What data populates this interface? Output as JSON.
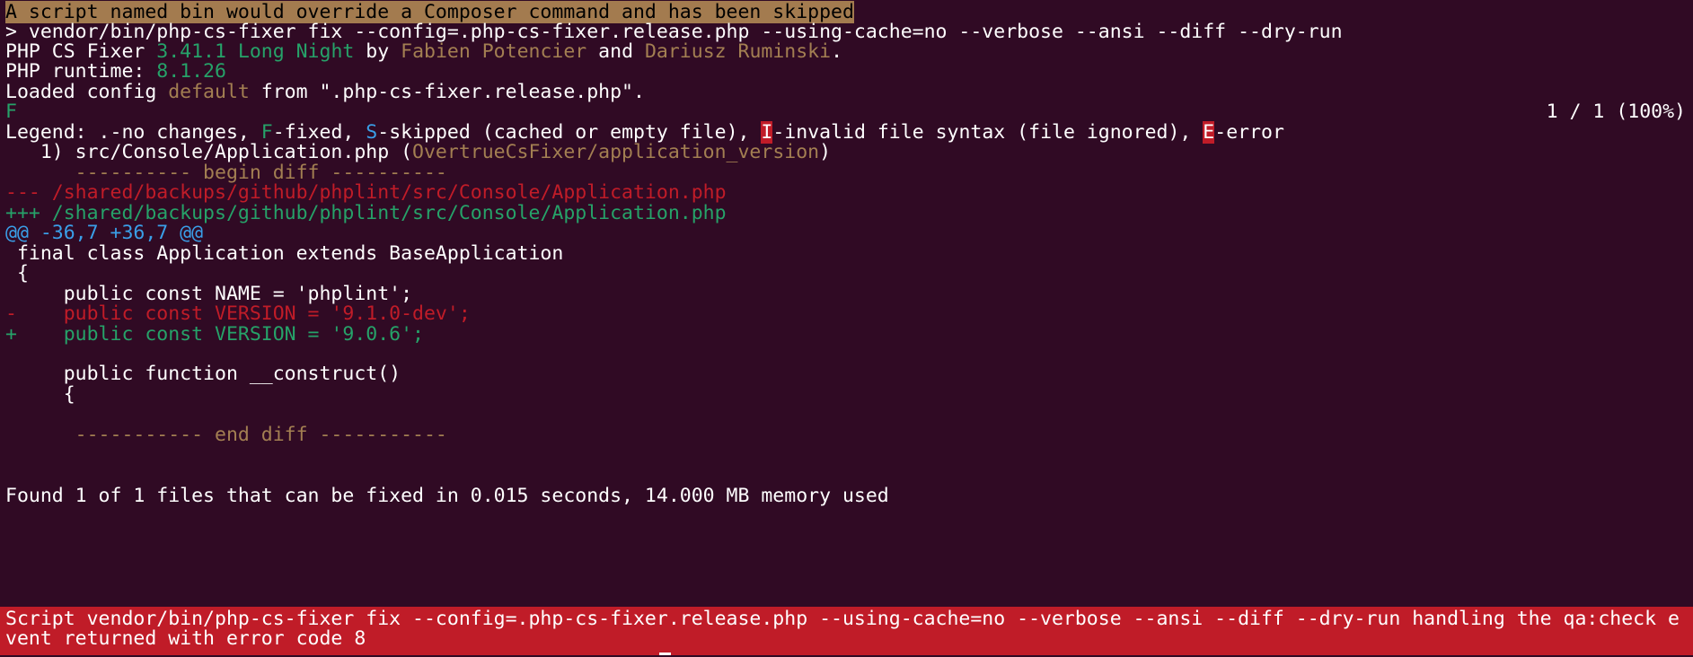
{
  "terminal": {
    "banner": "A script named bin would override a Composer command and has been skipped",
    "command_line": "> vendor/bin/php-cs-fixer fix --config=.php-cs-fixer.release.php --using-cache=no --verbose --ansi --diff --dry-run",
    "version_line": {
      "p1": "PHP CS Fixer ",
      "version": "3.41.1 Long Night",
      "p2": " by ",
      "author1": "Fabien Potencier",
      "p3": " and ",
      "author2": "Dariusz Ruminski",
      "p4": "."
    },
    "runtime_line": {
      "label": "PHP runtime: ",
      "version": "8.1.26"
    },
    "config_line": {
      "p1": "Loaded config ",
      "name": "default",
      "p2": " from \".php-cs-fixer.release.php\"."
    },
    "progress": {
      "marker": "F",
      "counter": "1 / 1 (100%)"
    },
    "legend": {
      "p1": "Legend: .-no changes, ",
      "f": "F",
      "p2": "-fixed, ",
      "s": "S",
      "p3": "-skipped (cached or empty file), ",
      "i": "I",
      "p4": "-invalid file syntax (file ignored), ",
      "e": "E",
      "p5": "-error"
    },
    "file_line": {
      "p1": "   1) src/Console/Application.php (",
      "rule": "OvertrueCsFixer/application_version",
      "p2": ")"
    },
    "begin_diff": "      ---------- begin diff ----------",
    "diff_minus_header": "--- /shared/backups/github/phplint/src/Console/Application.php",
    "diff_plus_header": "+++ /shared/backups/github/phplint/src/Console/Application.php",
    "hunk_header": "@@ -36,7 +36,7 @@",
    "code_lines": [
      " final class Application extends BaseApplication",
      " {",
      "     public const NAME = 'phplint';"
    ],
    "removed_line": "-    public const VERSION = '9.1.0-dev';",
    "added_line": "+    public const VERSION = '9.0.6';",
    "code_lines_after": [
      "",
      "     public function __construct()",
      "     {"
    ],
    "end_diff": "      ----------- end diff -----------",
    "summary": "Found 1 of 1 files that can be fixed in 0.015 seconds, 14.000 MB memory used",
    "error_lines": [
      "Script vendor/bin/php-cs-fixer fix --config=.php-cs-fixer.release.php --using-cache=no --verbose --ansi --diff --dry-run handling the qa:check e",
      "vent returned with error code 8"
    ]
  },
  "colors": {
    "background": "#300a24",
    "text": "#ffffff",
    "green": "#26a269",
    "red": "#c01c28",
    "blue": "#3a9fe8",
    "brown": "#a37f52"
  }
}
